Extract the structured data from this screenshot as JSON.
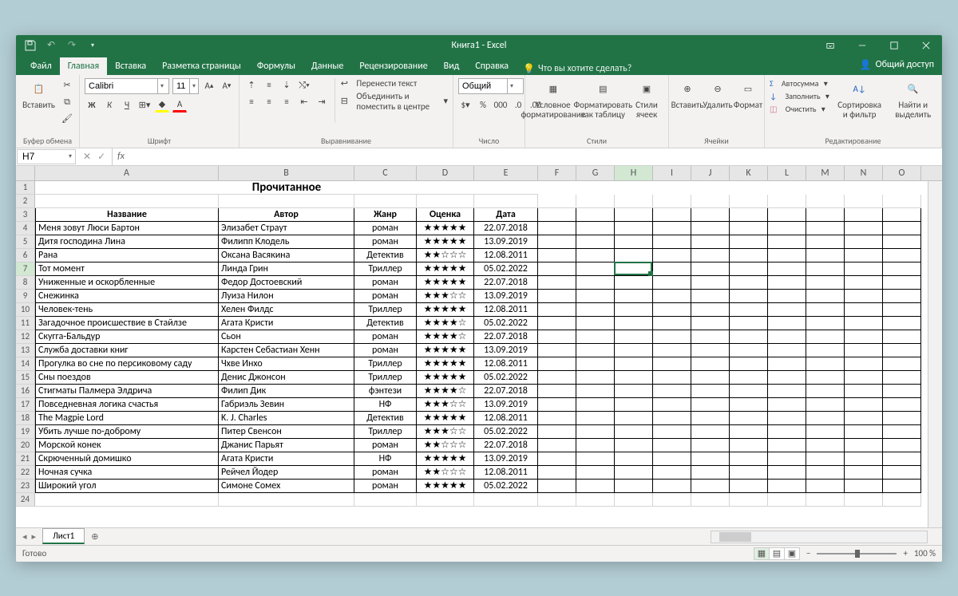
{
  "window": {
    "title": "Книга1  -  Excel"
  },
  "tabs": {
    "file": "Файл",
    "items": [
      "Главная",
      "Вставка",
      "Разметка страницы",
      "Формулы",
      "Данные",
      "Рецензирование",
      "Вид",
      "Справка"
    ],
    "active": 0,
    "tell_me": "Что вы хотите сделать?",
    "share": "Общий доступ"
  },
  "ribbon": {
    "clipboard": {
      "paste": "Вставить",
      "label": "Буфер обмена"
    },
    "font": {
      "name": "Calibri",
      "size": "11",
      "bold": "Ж",
      "italic": "К",
      "underline": "Ч",
      "label": "Шрифт"
    },
    "alignment": {
      "wrap": "Перенести текст",
      "merge": "Объединить и поместить в центре",
      "label": "Выравнивание"
    },
    "number": {
      "format": "Общий",
      "label": "Число"
    },
    "styles": {
      "conditional": "Условное форматирование",
      "table": "Форматировать как таблицу",
      "cell": "Стили ячеек",
      "label": "Стили"
    },
    "cells": {
      "insert": "Вставить",
      "delete": "Удалить",
      "format": "Формат",
      "label": "Ячейки"
    },
    "editing": {
      "autosum": "Автосумма",
      "fill": "Заполнить",
      "clear": "Очистить",
      "sort": "Сортировка и фильтр",
      "find": "Найти и выделить",
      "label": "Редактирование"
    }
  },
  "namebox": "H7",
  "columns": [
    "A",
    "B",
    "C",
    "D",
    "E",
    "F",
    "G",
    "H",
    "I",
    "J",
    "K",
    "L",
    "M",
    "N",
    "O"
  ],
  "selected_col": "H",
  "selected_row": 7,
  "spreadsheet": {
    "title": "Прочитанное",
    "headers": [
      "Название",
      "Автор",
      "Жанр",
      "Оценка",
      "Дата"
    ],
    "rows": [
      [
        "Меня зовут Люси Бартон",
        "Элизабет Страут",
        "роман",
        "★★★★★",
        "22.07.2018"
      ],
      [
        "Дитя господина Лина",
        "Филипп Клодель",
        "роман",
        "★★★★★",
        "13.09.2019"
      ],
      [
        "Рана",
        "Оксана Васякина",
        "Детектив",
        "★★☆☆☆",
        "12.08.2011"
      ],
      [
        "Тот момент",
        "Линда Грин",
        "Триллер",
        "★★★★★",
        "05.02.2022"
      ],
      [
        "Униженные и оскорбленные",
        "Федор Достоевский",
        "роман",
        "★★★★★",
        "22.07.2018"
      ],
      [
        "Снежинка",
        "Луиза Нилон",
        "роман",
        "★★★☆☆",
        "13.09.2019"
      ],
      [
        "Человек-тень",
        "Хелен Филдс",
        "Триллер",
        "★★★★★",
        "12.08.2011"
      ],
      [
        "Загадочное происшествие в Стайлзе",
        "Агата Кристи",
        "Детектив",
        "★★★★☆",
        "05.02.2022"
      ],
      [
        "Скугга-Бальдур",
        "Сьон",
        "роман",
        "★★★★☆",
        "22.07.2018"
      ],
      [
        "Служба доставки книг",
        "Карстен Себастиан Хенн",
        "роман",
        "★★★★★",
        "13.09.2019"
      ],
      [
        "Прогулка во сне по персиковому саду",
        "Чхве Инхо",
        "Триллер",
        "★★★★★",
        "12.08.2011"
      ],
      [
        "Сны поездов",
        "Денис Джонсон",
        "Триллер",
        "★★★★★",
        "05.02.2022"
      ],
      [
        "Стигматы Палмера Элдрича",
        "Филип Дик",
        "фэнтези",
        "★★★★☆",
        "22.07.2018"
      ],
      [
        "Повседневная логика счастья",
        "Габриэль Зевин",
        "НФ",
        "★★★☆☆",
        "13.09.2019"
      ],
      [
        "The Magpie Lord",
        "K. J. Charles",
        "Детектив",
        "★★★★★",
        "12.08.2011"
      ],
      [
        "Убить лучше по-доброму",
        "Питер Свенсон",
        "Триллер",
        "★★★☆☆",
        "05.02.2022"
      ],
      [
        "Морской конек",
        "Джанис Парьят",
        "роман",
        "★★☆☆☆",
        "22.07.2018"
      ],
      [
        "Скрюченный домишко",
        "Агата Кристи",
        "НФ",
        "★★★★★",
        "13.09.2019"
      ],
      [
        "Ночная сучка",
        "Рейчел Йодер",
        "роман",
        "★★☆☆☆",
        "12.08.2011"
      ],
      [
        "Широкий угол",
        "Симоне Сомех",
        "роман",
        "★★★★★",
        "05.02.2022"
      ]
    ]
  },
  "sheet_tab": "Лист1",
  "status": {
    "ready": "Готово",
    "zoom": "100 %"
  }
}
